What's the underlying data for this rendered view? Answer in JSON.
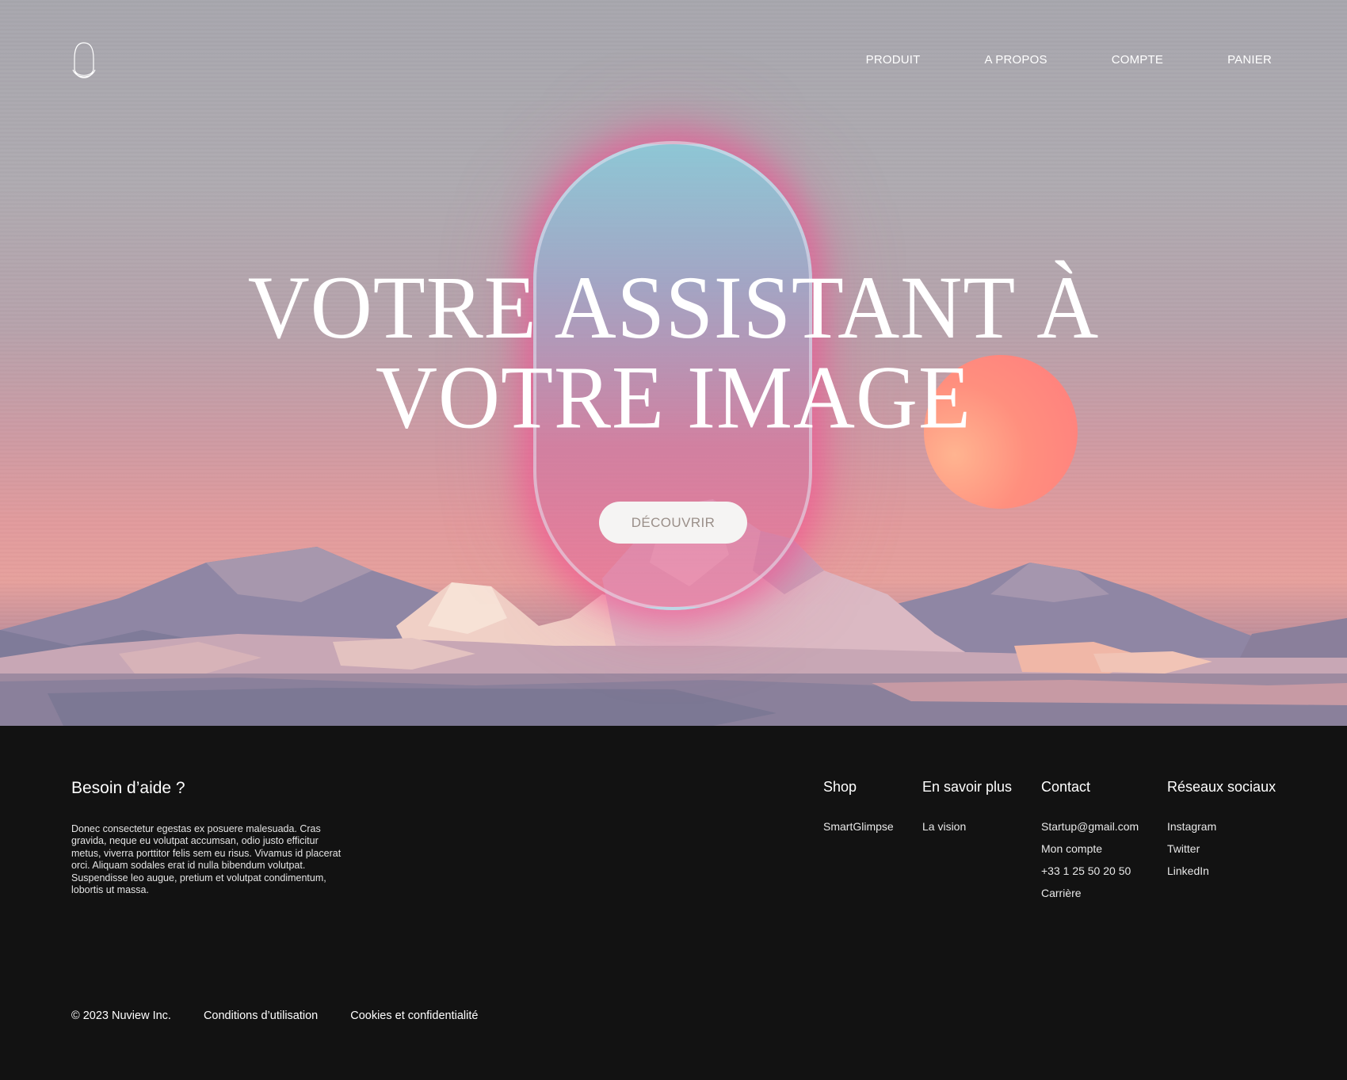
{
  "header": {
    "logo": "nuview-logo",
    "nav": [
      "PRODUIT",
      "A PROPOS",
      "COMPTE",
      "PANIER"
    ]
  },
  "hero": {
    "headline_line1": "VOTRE ASSISTANT À",
    "headline_line2": "VOTRE IMAGE",
    "cta_label": "DÉCOUVRIR",
    "colors": {
      "sun": "#ff8f7e",
      "glow": "#f5468c",
      "orb_top": "#8cc8d7"
    }
  },
  "footer": {
    "help_title": "Besoin d’aide ?",
    "help_text": "Donec consectetur egestas ex posuere malesuada. Cras gravida, neque eu volutpat accumsan, odio justo efficitur metus, viverra porttitor felis sem eu risus. Vivamus id placerat orci. Aliquam sodales erat id nulla bibendum volutpat. Suspendisse leo augue, pretium et volutpat condimentum, lobortis ut massa.",
    "columns": [
      {
        "title": "Shop",
        "links": [
          "SmartGlimpse"
        ]
      },
      {
        "title": "En savoir plus",
        "links": [
          "La vision"
        ]
      },
      {
        "title": "Contact",
        "links": [
          "Startup@gmail.com",
          "Mon compte",
          "+33 1 25 50 20 50",
          "Carrière"
        ]
      },
      {
        "title": "Réseaux sociaux",
        "links": [
          "Instagram",
          "Twitter",
          "LinkedIn"
        ]
      }
    ],
    "copyright": "© 2023 Nuview Inc.",
    "terms": "Conditions d’utilisation",
    "privacy": "Cookies et confidentialité"
  }
}
